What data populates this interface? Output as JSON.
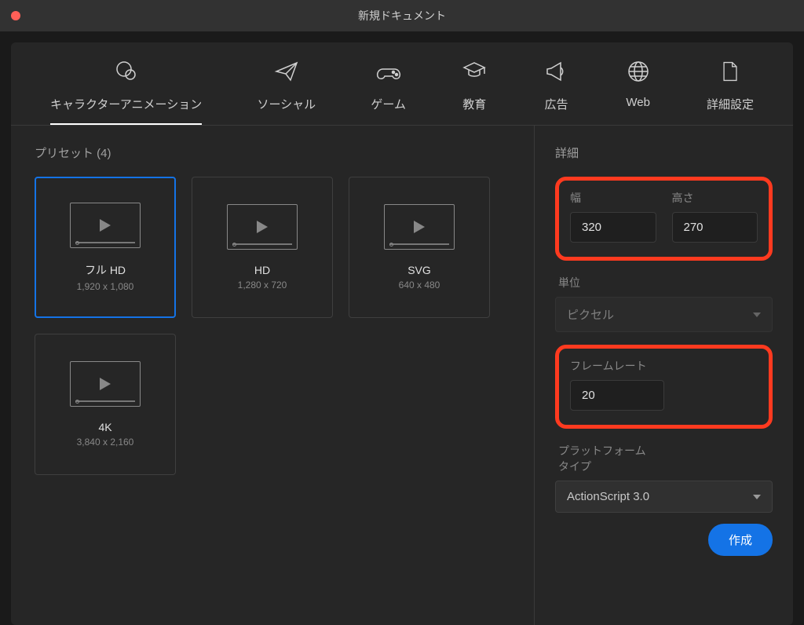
{
  "window": {
    "title": "新規ドキュメント"
  },
  "tabs": {
    "character": "キャラクターアニメーション",
    "social": "ソーシャル",
    "game": "ゲーム",
    "education": "教育",
    "ads": "広告",
    "web": "Web",
    "advanced": "詳細設定"
  },
  "presets": {
    "title": "プリセット (4)",
    "items": [
      {
        "name": "フル HD",
        "dim": "1,920 x 1,080"
      },
      {
        "name": "HD",
        "dim": "1,280 x 720"
      },
      {
        "name": "SVG",
        "dim": "640 x 480"
      },
      {
        "name": "4K",
        "dim": "3,840 x 2,160"
      }
    ]
  },
  "details": {
    "title": "詳細",
    "width_label": "幅",
    "height_label": "高さ",
    "width_value": "320",
    "height_value": "270",
    "units_label": "単位",
    "units_value": "ピクセル",
    "framerate_label": "フレームレート",
    "framerate_value": "20",
    "platform_label": "プラットフォームタイプ",
    "platform_value": "ActionScript 3.0",
    "create_label": "作成"
  }
}
